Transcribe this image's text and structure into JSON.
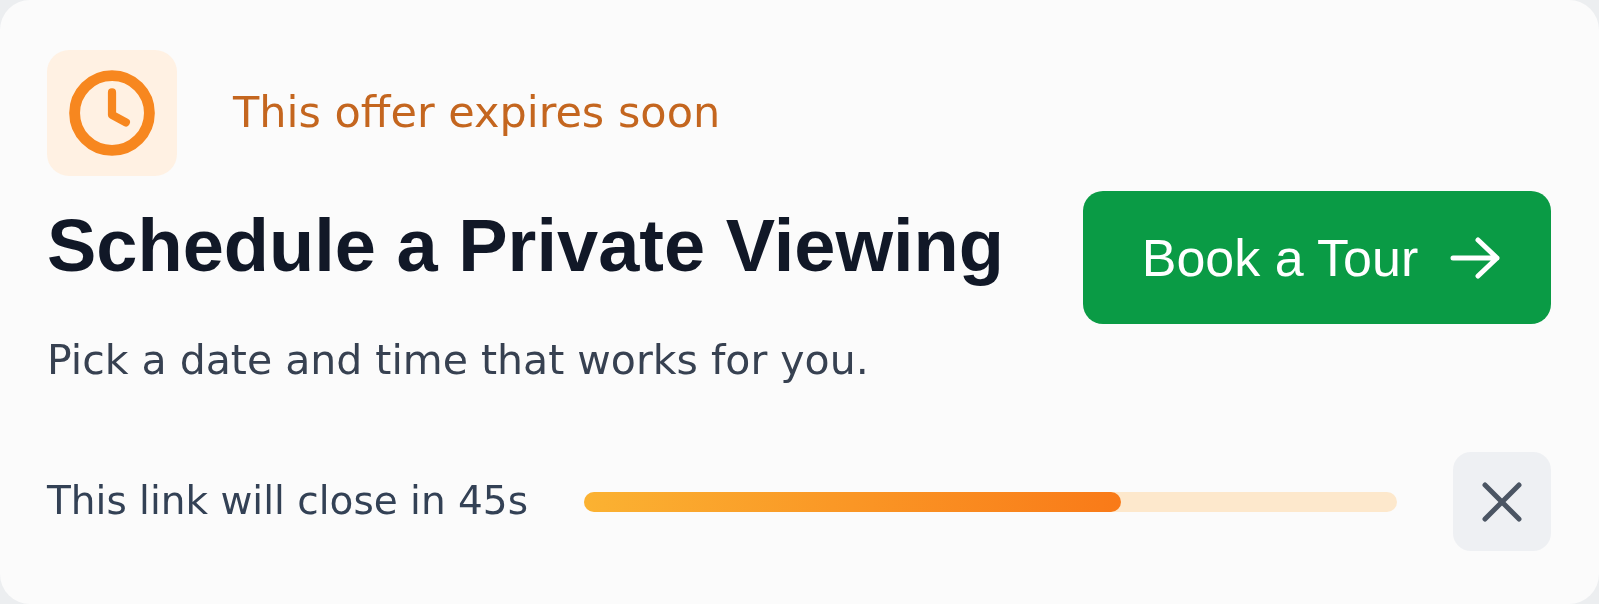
{
  "offer": {
    "text": "This offer expires soon"
  },
  "heading": {
    "title": "Schedule a Private Viewing",
    "subtitle": "Pick a date and time that works for you."
  },
  "primary_button": {
    "label": "Book a Tour"
  },
  "timer": {
    "text": "This link will close in 45s",
    "level": 0.66
  }
}
